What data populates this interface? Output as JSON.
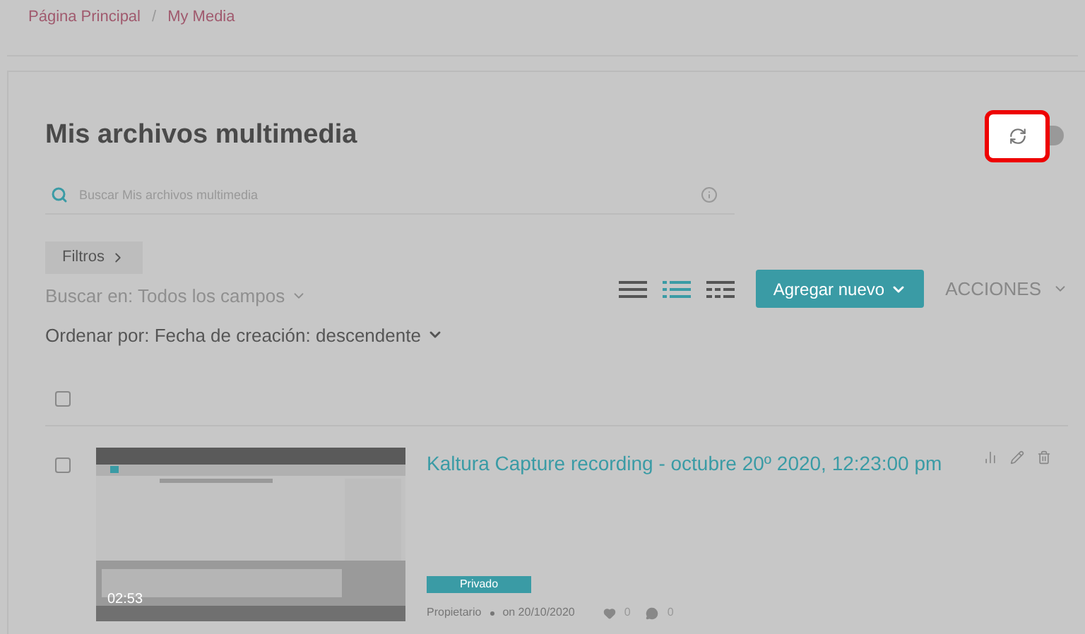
{
  "breadcrumb": [
    "Página Principal",
    "My Media"
  ],
  "breadcrumb_separator": "/",
  "title": "Mis archivos multimedia",
  "search": {
    "placeholder": "Buscar Mis archivos multimedia"
  },
  "filters_button": "Filtros",
  "search_in": "Buscar en: Todos los campos",
  "sort": "Ordenar por: Fecha de creación: descendente",
  "select_all": {
    "checked": false
  },
  "views": [
    {
      "kind": "lines",
      "selected": false
    },
    {
      "kind": "details",
      "selected": true
    },
    {
      "kind": "table",
      "selected": false
    }
  ],
  "add_button": "Agregar nuevo",
  "actions": "ACCIONES",
  "entries": [
    {
      "checked": false,
      "duration": "02:53",
      "title": "Kaltura Capture recording - octubre 20º 2020, 12:23:00 pm",
      "badge": "Privado",
      "owner": "Propietario",
      "date": "on 20/10/2020",
      "likes": "0",
      "comments": "0"
    }
  ]
}
